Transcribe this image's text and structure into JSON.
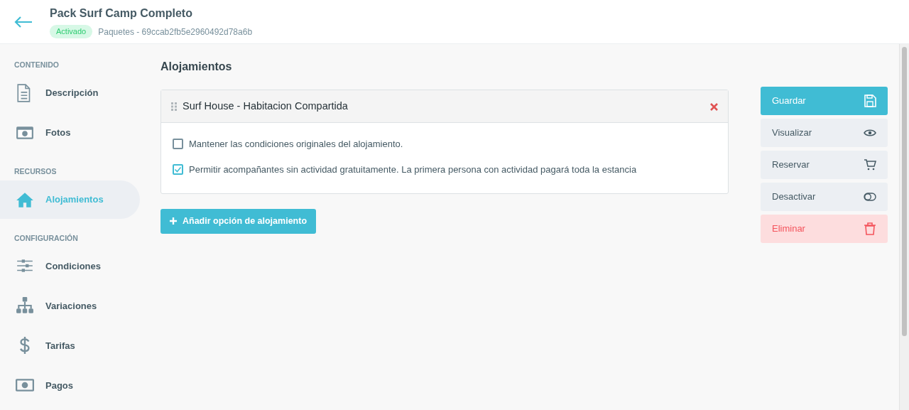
{
  "header": {
    "title": "Pack Surf Camp Completo",
    "status": "Activado",
    "breadcrumb": "Paquetes - 69ccab2fb5e2960492d78a6b"
  },
  "sidebar": [
    {
      "heading": "CONTENIDO",
      "items": [
        {
          "label": "Descripción",
          "selected": false
        },
        {
          "label": "Fotos",
          "selected": false
        }
      ]
    },
    {
      "heading": "RECURSOS",
      "items": [
        {
          "label": "Alojamientos",
          "selected": true
        }
      ]
    },
    {
      "heading": "CONFIGURACIÓN",
      "items": [
        {
          "label": "Condiciones",
          "selected": false
        },
        {
          "label": "Variaciones",
          "selected": false
        },
        {
          "label": "Tarifas",
          "selected": false
        },
        {
          "label": "Pagos",
          "selected": false
        }
      ]
    }
  ],
  "main": {
    "title": "Alojamientos",
    "options": [
      {
        "name": "Surf House - Habitacion Compartida",
        "checks": [
          {
            "label": "Mantener las condiciones originales del alojamiento.",
            "checked": false
          },
          {
            "label": "Permitir acompañantes sin actividad gratuitamente. La primera persona con actividad pagará toda la estancia",
            "checked": true
          }
        ]
      }
    ],
    "add_button": "Añadir opción de alojamiento"
  },
  "actions": [
    {
      "label": "Guardar",
      "kind": "primary"
    },
    {
      "label": "Visualizar",
      "kind": "secondary"
    },
    {
      "label": "Reservar",
      "kind": "secondary"
    },
    {
      "label": "Desactivar",
      "kind": "secondary"
    },
    {
      "label": "Eliminar",
      "kind": "danger"
    }
  ]
}
